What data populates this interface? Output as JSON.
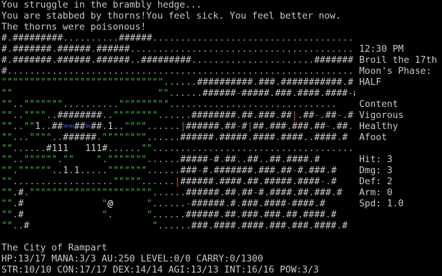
{
  "messages": [
    "You struggle in the brambly hedge...",
    "You are stabbed by thorns!You feel sick. You feel better now.",
    "The thorns were poisonous!"
  ],
  "map_rows": [
    "#.#########..........######.........................................",
    "#.#######.######.######.............................................",
    "#.#######.######.######..#########......................#######....#",
    "#......................................................................#",
    "\"\"\"\"\"\"\"\"\"\"\"\"\"\"\"\"\"\"\"\"\"\"\"\"\"\"\"\"\"......##########.###.###########.#",
    "\"\"                          \"\"......######-#####.###.####.####-####.#",
    "\"\"..\"\"\"\"\"\"\"..........\"\"\"\"\"\"\"\"\"..............................",
    "\"\"..\"\"\"\"..########..\"\"\"\"\"\"\"\"......########.##.###.##|.##-.##-.#",
    "\"\"..\"\"1..##==##=##.1..\"\"\"\"......|######.##-#|##.###.###.##-.##.",
    "\"\"...\"\"\"\"..######.\"\"\"\"\"\"\"\"......######.#####.####.####..####.#",
    "\"\"......#111   111#......\"\"......................................",
    "\"\"..\"\"\"\"\"\".\"\"    \".\"\"\"\"\"\"\"......#####-#.##..##..##.####.#",
    "\"\".\"\"\"\"\"\"..1.1.....\"\"\"\"\"\"\"......###-#.#######.###.##-#.###.#",
    "\"\"..................\"\"\"\"\"......|######.####.##.#####.####-.#",
    "\"\".#.\"\"\"\"\"\"\"\"\"\"\"\"\"\"\"\"\"\"\"\"\"\"......######.##.##-#.####.##.###.#",
    "\"\".#              \"@      \"......-######.#.###.####-####.#",
    "\"\".#              \".      \"......######.##.###.###.##.####.#",
    "\"\"..#                      \"......###.####.####.###.###.####.#"
  ],
  "sidebar": {
    "time": "12:30 PM",
    "date": "Broil the 17th",
    "moon_label": "Moon's Phase:",
    "moon_phase": "HALF",
    "mood": "Content",
    "energy": "Vigorous",
    "health": "Healthy",
    "movement": "Afoot",
    "hit": "Hit: 3",
    "dmg": "Dmg: 3",
    "def": "Def: 2",
    "arm": "Arm: 0",
    "spd": "Spd: 1.0"
  },
  "location": "The City of Rampart",
  "status_line_1": "HP:13/17 MANA:3/3 AU:250 LEVEL:0/0 CARRY:0/1300",
  "status_line_2": "STR:10/10 CON:17/17 DEX:14/14 AGI:13/13 INT:16/16 POW:3/3",
  "colors": {
    "background": "#000000",
    "text": "#c8c8c8",
    "hedge": "#3bbf3b",
    "door": "#c86a2a",
    "water": "#3a5fd6",
    "player": "#ffffff"
  }
}
